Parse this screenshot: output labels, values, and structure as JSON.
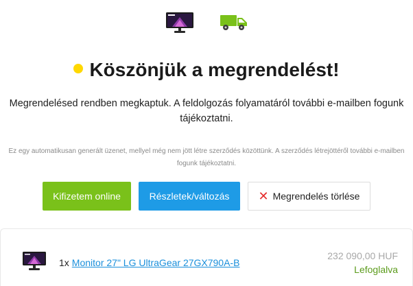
{
  "icons": {
    "monitor": "monitor-icon",
    "truck": "delivery-truck-icon"
  },
  "colors": {
    "accent_yellow": "#ffd800",
    "pay_green": "#7ac11a",
    "details_blue": "#1e9be6",
    "cancel_red": "#e52d2d",
    "status_green": "#5b9b1b",
    "link_blue": "#1a8fdb"
  },
  "heading": "Köszönjük a megrendelést!",
  "message": "Megrendelésed rendben megkaptuk. A feldolgozás folyamatáról további e-mailben fogunk tájékoztatni.",
  "notice": "Ez egy automatikusan generált üzenet, mellyel még nem jött létre szerződés közöttünk. A szerződés létrejöttéről további e-mailben fogunk tájékoztatni.",
  "buttons": {
    "pay": "Kifizetem online",
    "details": "Részletek/változás",
    "cancel": "Megrendelés törlése"
  },
  "order": {
    "quantity": "1x",
    "product": "Monitor 27\" LG UltraGear 27GX790A-B",
    "price": "232 090,00 HUF",
    "status": "Lefoglalva"
  }
}
